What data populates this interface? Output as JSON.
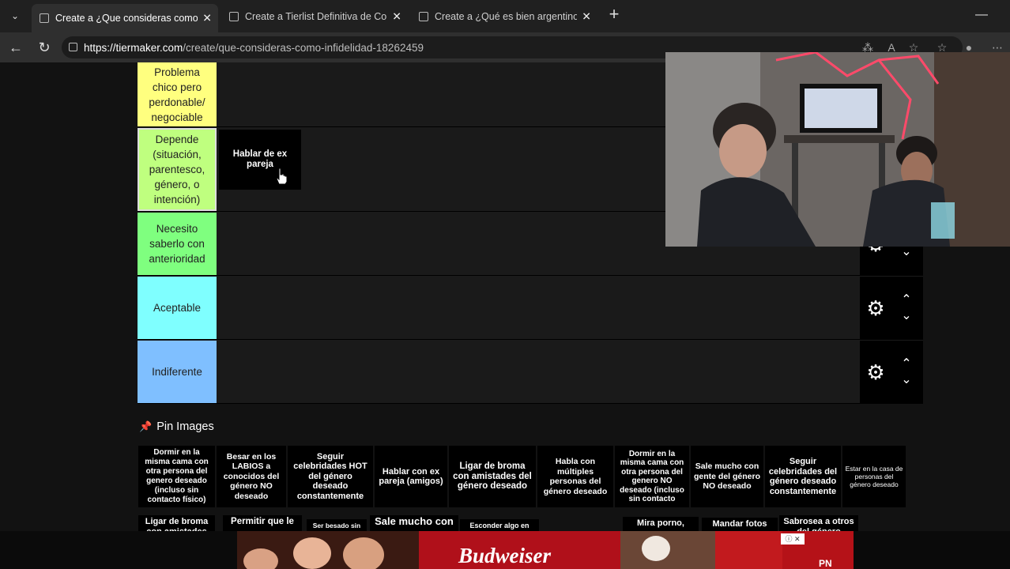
{
  "browser": {
    "tabs": [
      {
        "title": "Create a ¿Que consideras como in",
        "active": true
      },
      {
        "title": "Create a Tierlist Definitiva de Com",
        "active": false
      },
      {
        "title": "Create a ¿Qué es bien argentino y",
        "active": false
      }
    ],
    "new_tab_label": "+",
    "url_domain": "https://tiermaker.com",
    "url_path": "/create/que-consideras-como-infidelidad-18262459"
  },
  "tiers": [
    {
      "label": "Problema chico pero perdonable/ negociable",
      "color": "#ffff7f"
    },
    {
      "label": "Depende (situación, parentesco, género, o intención)",
      "color": "#bfff7f"
    },
    {
      "label": "Necesito saberlo con anterioridad",
      "color": "#7fff7f"
    },
    {
      "label": "Aceptable",
      "color": "#7fffff"
    },
    {
      "label": "Indiferente",
      "color": "#7fbfff"
    }
  ],
  "placed_items": [
    {
      "text": "Hablar de ex pareja"
    }
  ],
  "pin": {
    "title": "Pin Images"
  },
  "pool_items_row1": [
    "Dormir en la misma cama con otra persona del genero deseado (incluso sin contacto físico)",
    "Besar en los LABIOS a conocidos del género NO deseado",
    "Seguir celebridades HOT del género deseado constantemente",
    "Hablar con ex pareja (amigos)",
    "Ligar de broma con amistades del género deseado",
    "Habla con múltiples personas del género deseado",
    "Dormir en la misma cama con otra persona del genero NO deseado (incluso sin contacto",
    "Sale mucho con gente del género NO deseado",
    "Seguir celebridades del género deseado constantemente",
    "Estar en la casa de personas del género deseado"
  ],
  "pool_items_row2": [
    "Ligar de broma con amistades de género NO deseado",
    "Permitir que le",
    "Ser besado sin",
    "Sale mucho con",
    "Esconder algo en",
    "Mira porno,",
    "Mandar fotos",
    "Sabrosea a otros del género deseado disimulando"
  ],
  "ad": {
    "brand": "Budweiser",
    "close_label": "ⓘ ✕",
    "logo": "PN"
  }
}
